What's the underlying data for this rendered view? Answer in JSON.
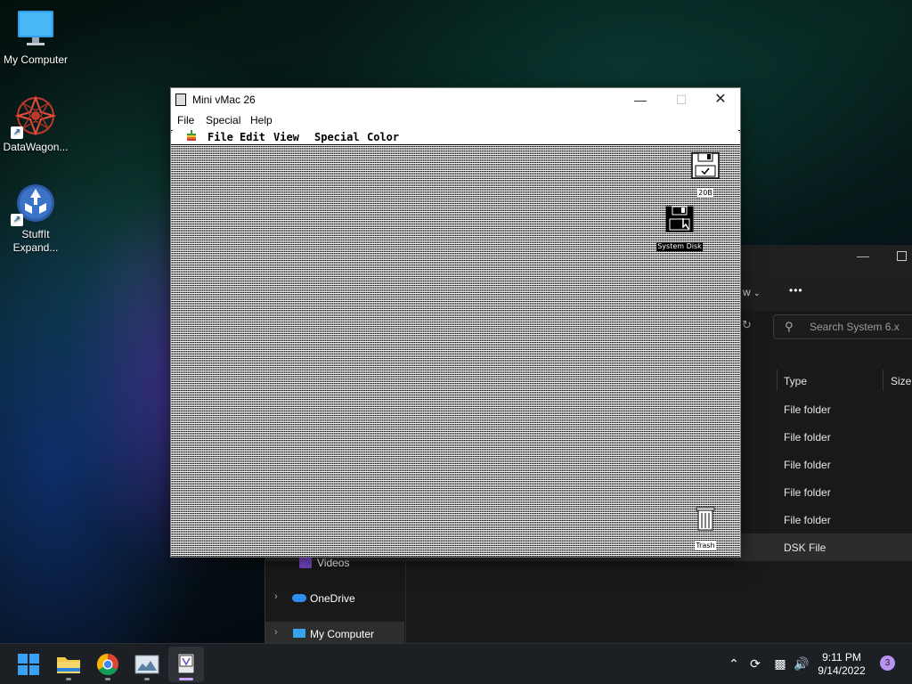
{
  "desktop": {
    "icons": [
      {
        "label": "My Computer",
        "icon": "monitor-icon"
      },
      {
        "label": "DataWagon...",
        "icon": "datawagon-icon"
      },
      {
        "label": "StuffIt Expand...",
        "icon": "stuffit-icon"
      }
    ]
  },
  "vmac_window": {
    "title": "Mini vMac 26",
    "menus": [
      "File",
      "Special",
      "Help"
    ],
    "mac_menubar": {
      "apple": "apple-icon",
      "menus": [
        "File",
        "Edit",
        "View",
        "Special",
        "Color"
      ]
    },
    "mac_icons": {
      "disk_top": "20B",
      "system_disk": "System Disk",
      "trash": "Trash"
    }
  },
  "explorer": {
    "search_placeholder": "Search System 6.x",
    "view_label": "w",
    "more_label": "•••",
    "columns": [
      "Type",
      "Size"
    ],
    "rows": [
      {
        "type": "File folder"
      },
      {
        "type": "File folder"
      },
      {
        "type": "File folder"
      },
      {
        "type": "File folder"
      },
      {
        "type": "File folder"
      },
      {
        "type": "DSK File"
      }
    ],
    "nav": [
      {
        "label": "Videos"
      },
      {
        "label": "OneDrive"
      },
      {
        "label": "My Computer"
      }
    ]
  },
  "taskbar": {
    "apps": [
      "start-icon",
      "file-explorer-icon",
      "chrome-icon",
      "photos-icon",
      "mini-vmac-icon"
    ],
    "time": "9:11 PM",
    "date": "9/14/2022",
    "notification_count": "3"
  },
  "colors": {
    "accent": "#c9a3ff",
    "taskbar": "#1c1f24"
  }
}
